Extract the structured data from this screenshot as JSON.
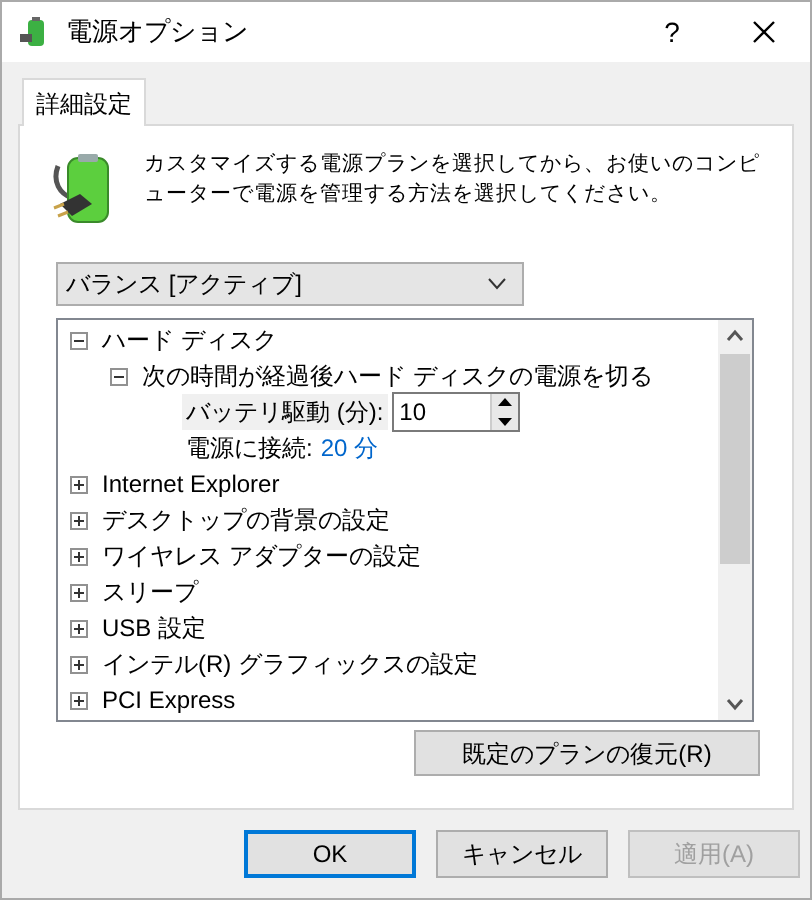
{
  "window": {
    "title": "電源オプション",
    "help": "?"
  },
  "tabs": [
    {
      "label": "詳細設定",
      "selected": true
    }
  ],
  "description": "カスタマイズする電源プランを選択してから、お使いのコンピューターで電源を管理する方法を選択してください。",
  "plan_dropdown": {
    "value": "バランス [アクティブ]"
  },
  "tree": [
    {
      "label": "ハード ディスク",
      "expanded": true,
      "children": [
        {
          "label": "次の時間が経過後ハード ディスクの電源を切る",
          "expanded": true,
          "settings": [
            {
              "kind": "spin",
              "label": "バッテリ駆動 (分):",
              "value": "10"
            },
            {
              "kind": "value",
              "label": "電源に接続:",
              "value": "20 分"
            }
          ]
        }
      ]
    },
    {
      "label": "Internet Explorer",
      "expanded": false
    },
    {
      "label": "デスクトップの背景の設定",
      "expanded": false
    },
    {
      "label": "ワイヤレス アダプターの設定",
      "expanded": false
    },
    {
      "label": "スリープ",
      "expanded": false
    },
    {
      "label": "USB 設定",
      "expanded": false
    },
    {
      "label": "インテル(R) グラフィックスの設定",
      "expanded": false
    },
    {
      "label": "PCI Express",
      "expanded": false
    }
  ],
  "restore_button": "既定のプランの復元(R)",
  "buttons": [
    {
      "label": "OK",
      "kind": "default"
    },
    {
      "label": "キャンセル",
      "kind": "normal"
    },
    {
      "label": "適用(A)",
      "kind": "disabled"
    }
  ]
}
